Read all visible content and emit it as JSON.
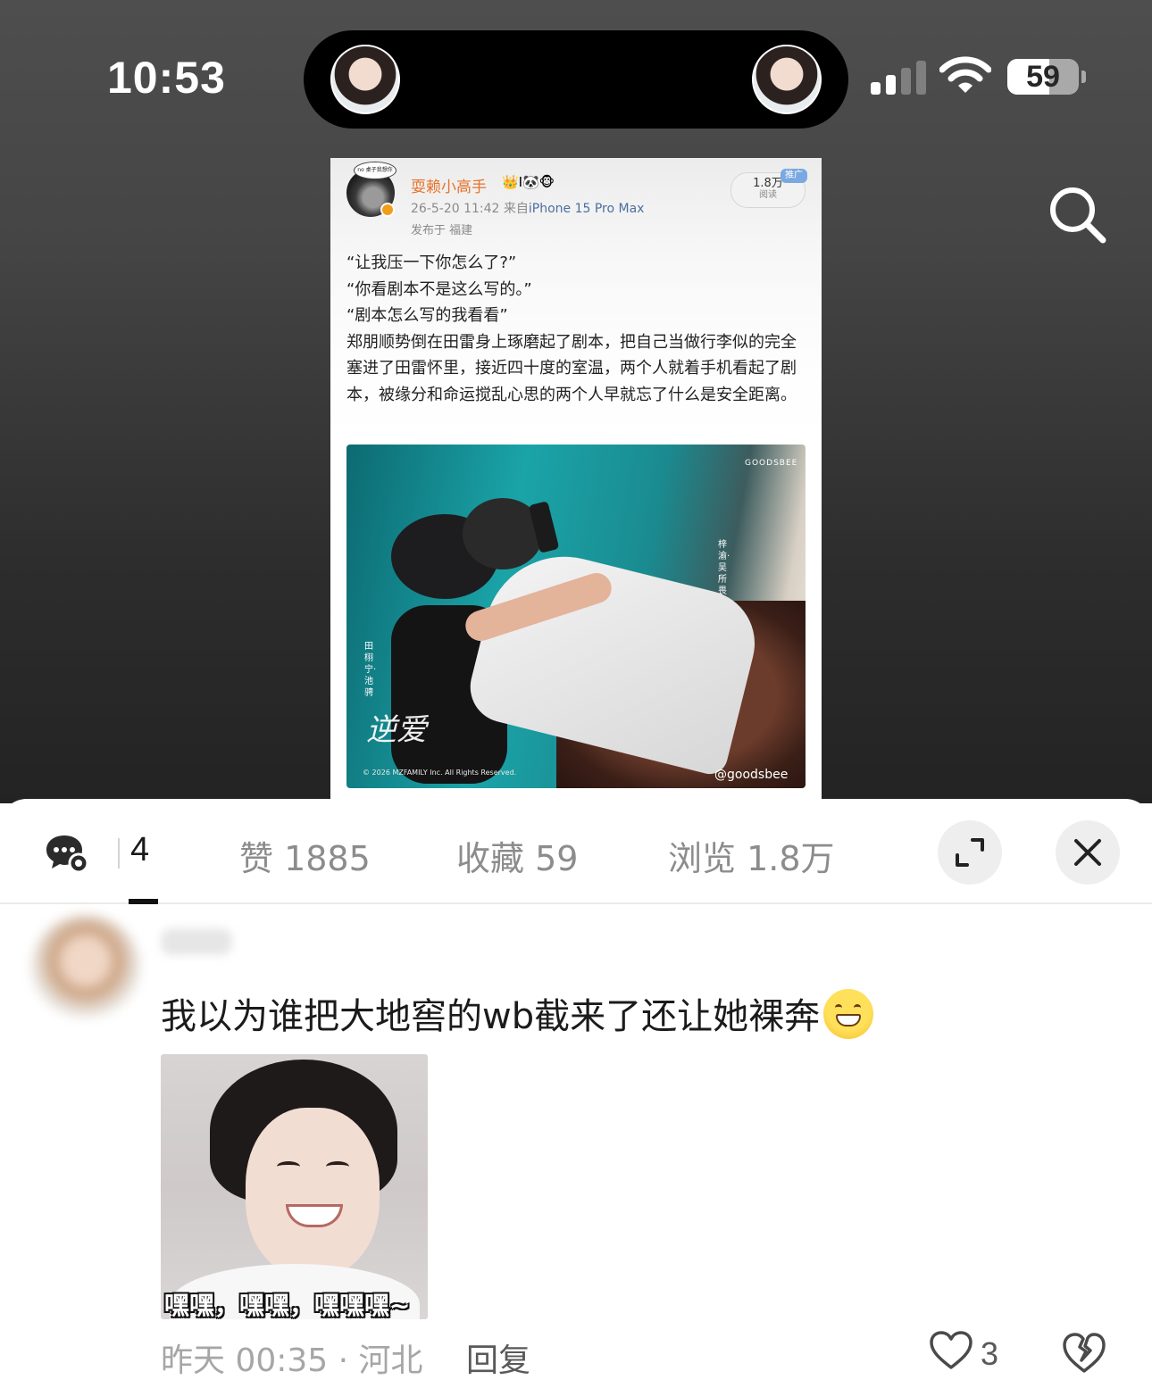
{
  "status_bar": {
    "time": "10:53",
    "battery": "59",
    "battery_level": 0.59
  },
  "post": {
    "author": "耍赖小高手",
    "author_badges": "👑I🐼🐵",
    "avatar_bubble": "no 桌子我想你",
    "meta_date": "26-5-20 11:42",
    "meta_source_prefix": "来自",
    "meta_device": "iPhone 15 Pro Max",
    "location": "发布于 福建",
    "read_count": "1.8万",
    "read_label": "阅读",
    "promo_tag": "推广",
    "lines": [
      "“让我压一下你怎么了?”",
      "“你看剧本不是这么写的。”",
      "“剧本怎么写的我看看”",
      "郑朋顺势倒在田雷身上琢磨起了剧本，把自己当做行李似的完全塞进了田雷怀里，接近四十度的室温，两个人就着手机看起了剧本，被缘分和命运搅乱心思的两个人早就忘了什么是安全距离。"
    ],
    "photo": {
      "brand_top": "GOODSBEE",
      "cast_right": "梓渝·吴所畏",
      "cast_left": "田栩宁·池骋",
      "logo_text": "逆爱",
      "copyright": "© 2026 MZFAMILY Inc. All Rights Reserved.",
      "handle": "@goodsbee"
    }
  },
  "sheet": {
    "comment_count": "4",
    "tabs": [
      {
        "label": "赞 1885"
      },
      {
        "label": "收藏 59"
      },
      {
        "label": "浏览 1.8万"
      }
    ]
  },
  "comment": {
    "text": "我以为谁把大地窖的wb截来了还让她裸奔",
    "sticker_caption": "嘿嘿，嘿嘿，嘿嘿嘿~",
    "meta": "昨天 00:35 · 河北",
    "reply_label": "回复",
    "like_count": "3"
  }
}
